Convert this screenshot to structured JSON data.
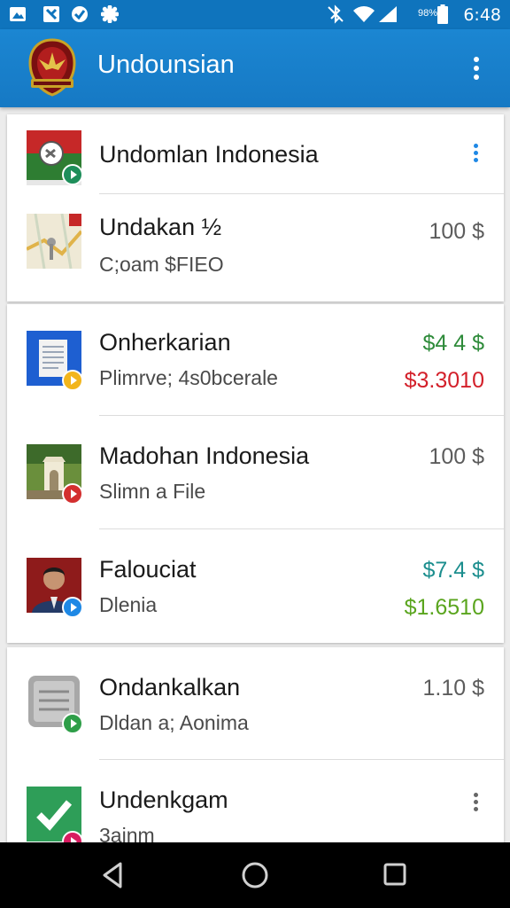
{
  "status_bar": {
    "battery": "98%",
    "time": "6:48"
  },
  "app_bar": {
    "title": "Undounsian"
  },
  "items": [
    {
      "title": "Undomlan Indonesia",
      "subtitle": "",
      "price": "",
      "price2": ""
    },
    {
      "title": "Undakan ½",
      "subtitle": "C;oam $FIEO",
      "price": "100 $",
      "price2": ""
    },
    {
      "title": "Onherkarian",
      "subtitle": "Plimrve; 4s0bcerale",
      "price": "$4 4 $",
      "price2": "$3.3010"
    },
    {
      "title": "Madohan Indonesia",
      "subtitle": "Slimn a File",
      "price": "100 $",
      "price2": ""
    },
    {
      "title": "Falouciat",
      "subtitle": "Dlenia",
      "price": "$7.4 $",
      "price2": "$1.6510"
    },
    {
      "title": "Ondankalkan",
      "subtitle": "Dldan a; Aonima",
      "price": "1.10 $",
      "price2": ""
    },
    {
      "title": "Undenkgam",
      "subtitle": "3ainm",
      "price": "",
      "price2": ""
    }
  ],
  "colors": {
    "primary": "#1679c4",
    "status_bar": "#0f74bd",
    "price_green": "#2e8b3a",
    "price_red": "#d3202a",
    "price_teal": "#1c8e8e",
    "price_lime": "#5aa51e",
    "menu_dots_blue": "#1e88e5"
  }
}
